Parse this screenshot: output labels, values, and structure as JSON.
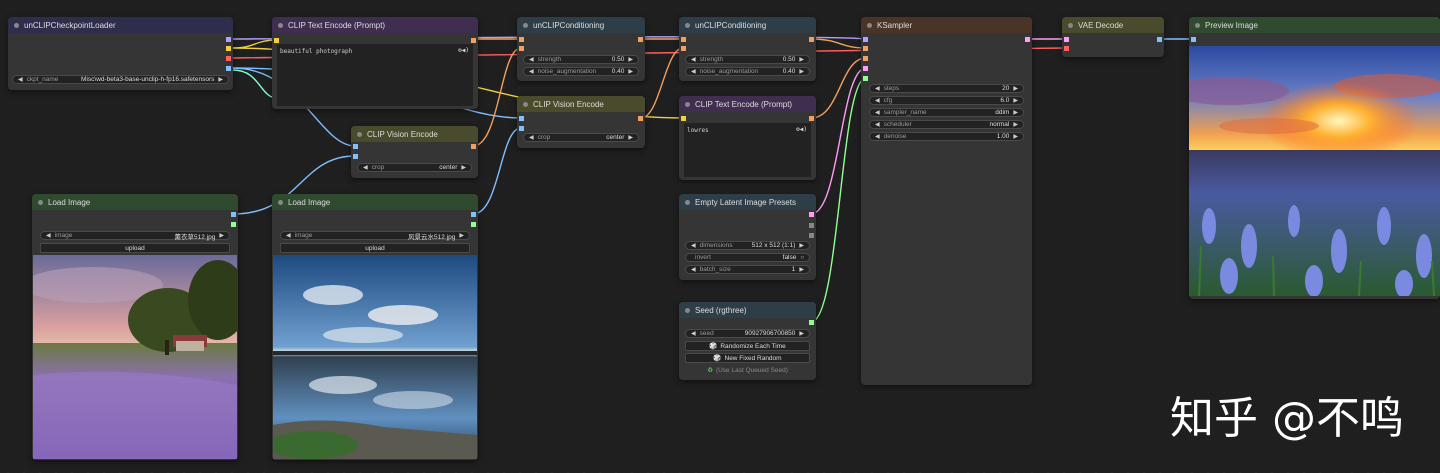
{
  "nodes": {
    "loader": {
      "title": "unCLIPCheckpointLoader",
      "ckpt_label": "ckpt_name",
      "ckpt_value": "Misc\\wd-beta3-base-unclip-h-fp16.safetensors"
    },
    "clip_text_1": {
      "title": "CLIP Text Encode (Prompt)",
      "text": "beautiful photograph"
    },
    "clip_vision_1": {
      "title": "CLIP Vision Encode",
      "crop_label": "crop",
      "crop_value": "center"
    },
    "load_image_1": {
      "title": "Load Image",
      "image_label": "image",
      "image_value": "薰衣草512.jpg",
      "upload_label": "upload"
    },
    "load_image_2": {
      "title": "Load Image",
      "image_label": "image",
      "image_value": "风景云水512.jpg",
      "upload_label": "upload"
    },
    "uncond_1": {
      "title": "unCLIPConditioning",
      "strength_label": "strength",
      "strength_value": "0.50",
      "noise_label": "noise_augmentation",
      "noise_value": "0.40"
    },
    "clip_vision_2": {
      "title": "CLIP Vision Encode",
      "crop_label": "crop",
      "crop_value": "center"
    },
    "uncond_2": {
      "title": "unCLIPConditioning",
      "strength_label": "strength",
      "strength_value": "0.50",
      "noise_label": "noise_augmentation",
      "noise_value": "0.40"
    },
    "clip_text_2": {
      "title": "CLIP Text Encode (Prompt)",
      "text": "lowres"
    },
    "latent": {
      "title": "Empty Latent Image Presets",
      "dim_label": "dimensions",
      "dim_value": "512 x 512 (1:1)",
      "invert_label": "invert",
      "invert_value": "false",
      "batch_label": "batch_size",
      "batch_value": "1"
    },
    "seed": {
      "title": "Seed (rgthree)",
      "seed_label": "seed",
      "seed_value": "909279067008​50",
      "randomize_label": "Randomize Each Time",
      "fixed_label": "New Fixed Random",
      "last_label": "(Use Last Queued Seed)"
    },
    "ksampler": {
      "title": "KSampler",
      "steps_label": "steps",
      "steps_value": "20",
      "cfg_label": "cfg",
      "cfg_value": "6.0",
      "sampler_label": "sampler_name",
      "sampler_value": "ddim",
      "scheduler_label": "scheduler",
      "scheduler_value": "normal",
      "denoise_label": "denoise",
      "denoise_value": "1.00"
    },
    "vae": {
      "title": "VAE Decode"
    },
    "preview": {
      "title": "Preview Image"
    }
  },
  "watermark": "知乎 @不鸣",
  "colors": {
    "clip": "#f0d040",
    "model": "#b0a0ff",
    "vae": "#ff6060",
    "conditioning": "#f0a060",
    "image": "#80c0ff",
    "latent": "#ff9cf9",
    "int": "#90ff90"
  }
}
